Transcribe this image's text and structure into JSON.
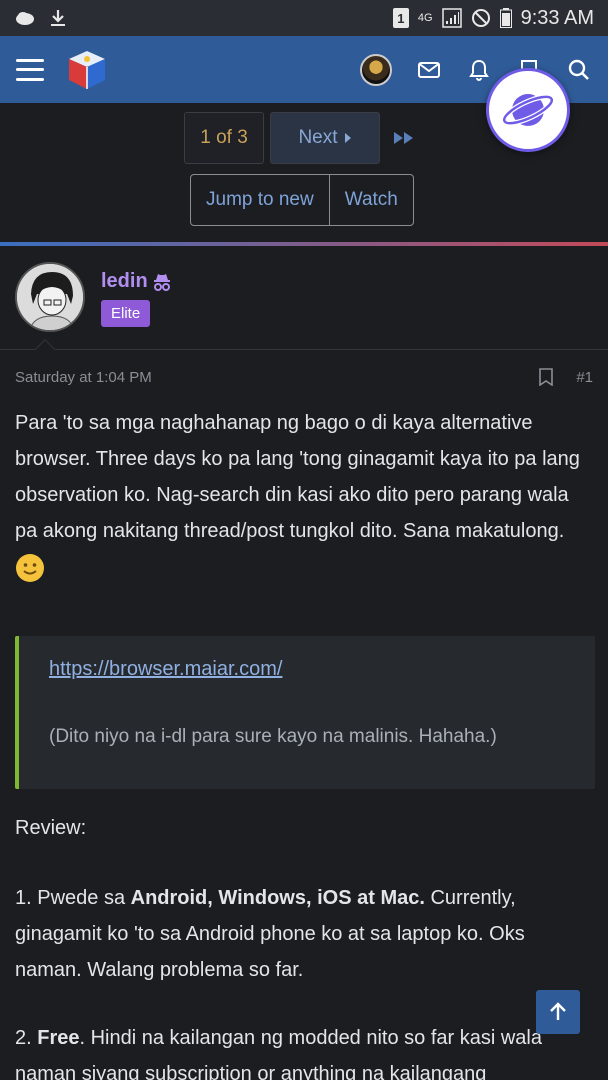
{
  "status_bar": {
    "network_type": "4G",
    "sim_badge": "1",
    "time": "9:33 AM",
    "icons": [
      "cloud-icon",
      "download-icon",
      "sim-badge",
      "signal-icon",
      "dnd-icon",
      "battery-icon"
    ]
  },
  "app_bar": {
    "icons": [
      "hamburger-icon",
      "forum-logo",
      "user-avatar",
      "envelope-icon",
      "bell-icon",
      "bookmark-icon",
      "search-icon"
    ],
    "brand_color": "#2f5c99"
  },
  "floating_button": {
    "icon": "planet-icon"
  },
  "pager": {
    "current": "1 of 3",
    "next_label": "Next"
  },
  "thread_actions": {
    "jump_label": "Jump to new",
    "watch_label": "Watch"
  },
  "post": {
    "author": "ledin",
    "badge": "Elite",
    "timestamp": "Saturday at 1:04 PM",
    "post_number": "#1",
    "paragraph1": "Para 'to sa mga naghahanap ng bago o di kaya alternative browser. Three days ko pa lang 'tong ginagamit kaya ito pa lang observation ko. Nag-search din kasi ako dito pero parang wala pa akong nakitang thread/post tungkol dito. Sana makatulong.",
    "quote_link": "https://browser.maiar.com/",
    "quote_note": "(Dito niyo na i-dl para sure kayo na malinis. Hahaha.)",
    "review_heading": "Review:",
    "item1_prefix": "1. Pwede sa ",
    "item1_bold": "Android, Windows, iOS at Mac.",
    "item1_rest": " Currently, ginagamit ko 'to sa Android phone ko at sa laptop ko. Oks naman. Walang problema so far.",
    "item2_prefix": "2. ",
    "item2_bold": "Free",
    "item2_rest": ". Hindi na kailangan ng modded nito so far kasi wala naman siyang subscription or anything na kailangang"
  }
}
